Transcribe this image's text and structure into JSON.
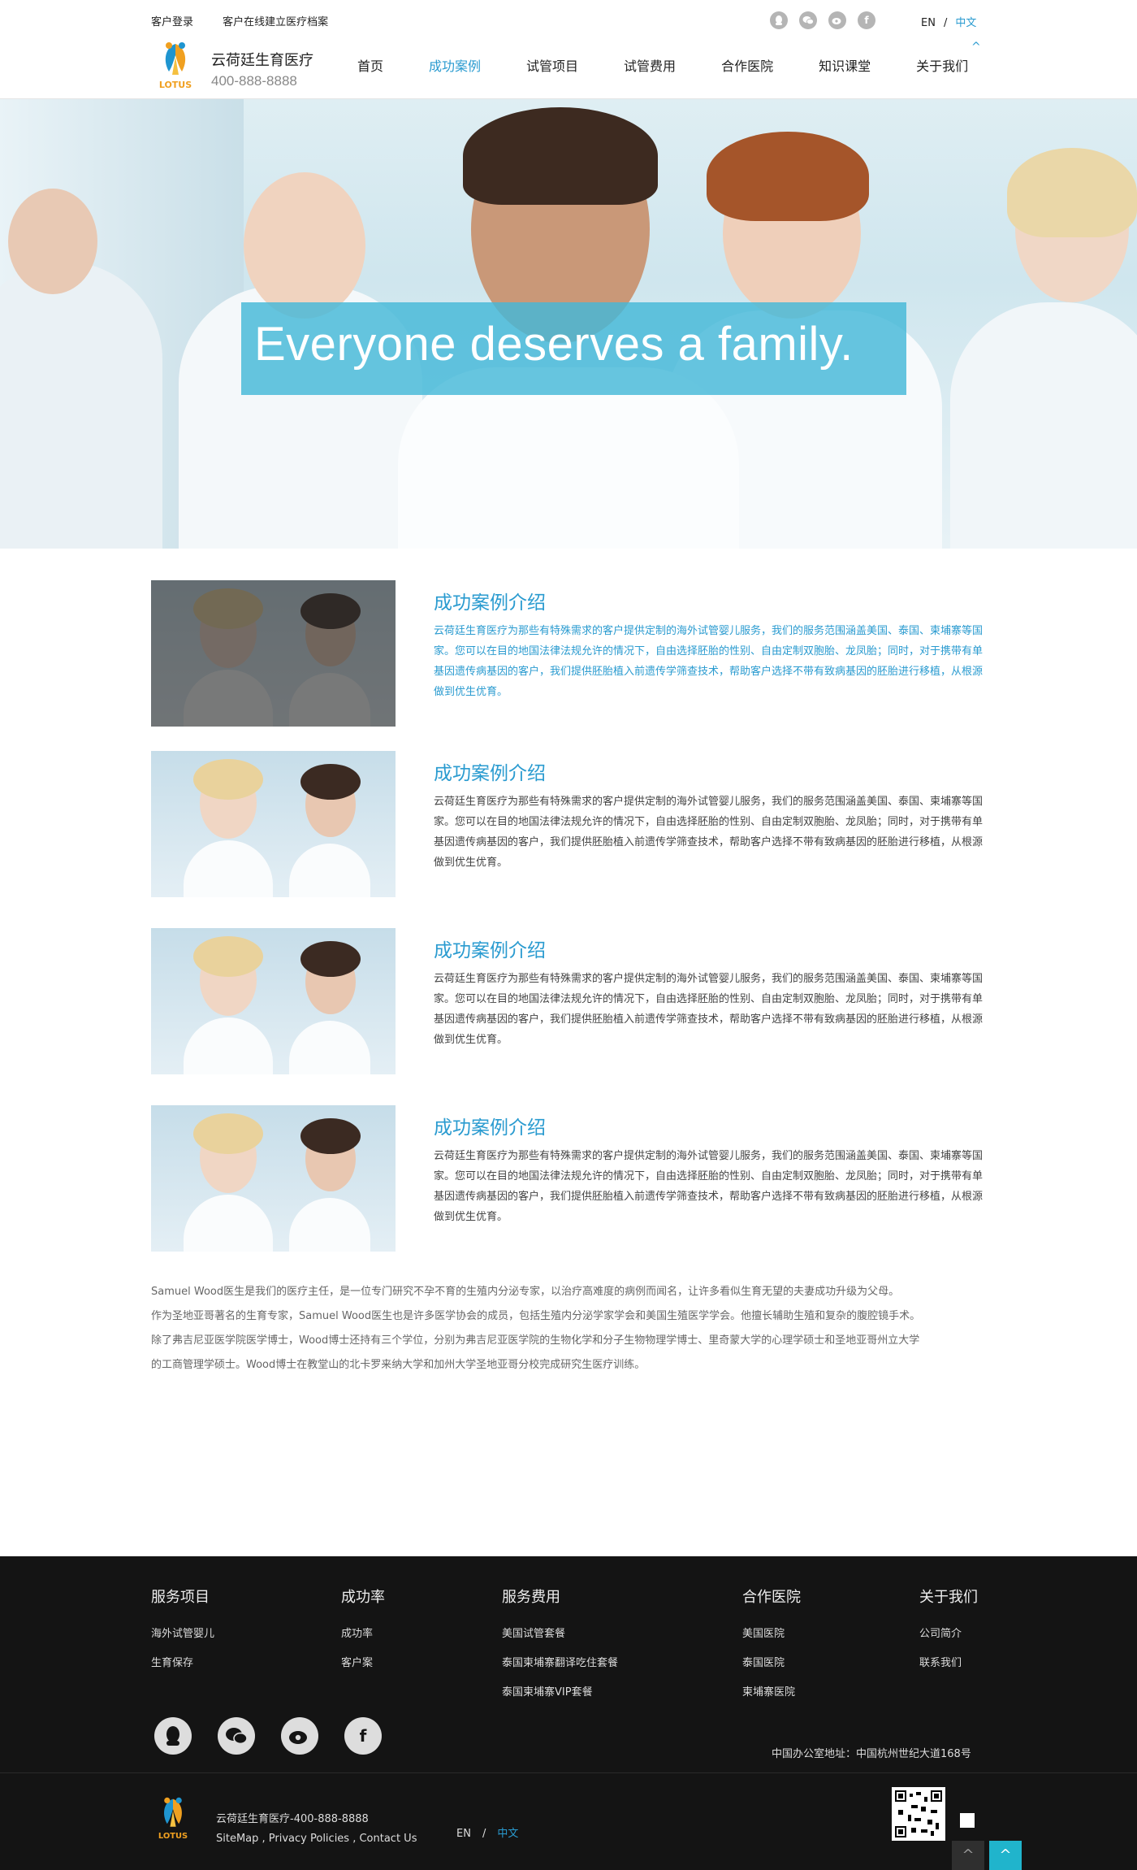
{
  "topbar": {
    "login": "客户登录",
    "archive": "客户在线建立医疗档案",
    "social_icons": [
      "qq-icon",
      "wechat-icon",
      "weibo-icon",
      "facebook-icon"
    ],
    "lang_en": "EN",
    "lang_sep": "/",
    "lang_cn": "中文"
  },
  "header": {
    "brand_name": "云荷廷生育医疗",
    "phone": "400-888-8888",
    "logo_text": "LOTUS",
    "caret": "^",
    "nav": [
      {
        "label": "首页",
        "active": false
      },
      {
        "label": "成功案例",
        "active": true
      },
      {
        "label": "试管项目",
        "active": false
      },
      {
        "label": "试管费用",
        "active": false
      },
      {
        "label": "合作医院",
        "active": false
      },
      {
        "label": "知识课堂",
        "active": false
      },
      {
        "label": "关于我们",
        "active": false
      }
    ]
  },
  "hero": {
    "caption": "Everyone deserves a family."
  },
  "cases": [
    {
      "title": "成功案例介绍",
      "desc": "云荷廷生育医疗为那些有特殊需求的客户提供定制的海外试管婴儿服务，我们的服务范围涵盖美国、泰国、柬埔寨等国家。您可以在目的地国法律法规允许的情况下，自由选择胚胎的性别、自由定制双胞胎、龙凤胎；同时，对于携带有单基因遗传病基因的客户，我们提供胚胎植入前遗传学筛查技术，帮助客户选择不带有致病基因的胚胎进行移植，从根源做到优生优育。"
    },
    {
      "title": "成功案例介绍",
      "desc": "云荷廷生育医疗为那些有特殊需求的客户提供定制的海外试管婴儿服务，我们的服务范围涵盖美国、泰国、柬埔寨等国家。您可以在目的地国法律法规允许的情况下，自由选择胚胎的性别、自由定制双胞胎、龙凤胎；同时，对于携带有单基因遗传病基因的客户，我们提供胚胎植入前遗传学筛查技术，帮助客户选择不带有致病基因的胚胎进行移植，从根源做到优生优育。"
    },
    {
      "title": "成功案例介绍",
      "desc": "云荷廷生育医疗为那些有特殊需求的客户提供定制的海外试管婴儿服务，我们的服务范围涵盖美国、泰国、柬埔寨等国家。您可以在目的地国法律法规允许的情况下，自由选择胚胎的性别、自由定制双胞胎、龙凤胎；同时，对于携带有单基因遗传病基因的客户，我们提供胚胎植入前遗传学筛查技术，帮助客户选择不带有致病基因的胚胎进行移植，从根源做到优生优育。"
    },
    {
      "title": "成功案例介绍",
      "desc": "云荷廷生育医疗为那些有特殊需求的客户提供定制的海外试管婴儿服务，我们的服务范围涵盖美国、泰国、柬埔寨等国家。您可以在目的地国法律法规允许的情况下，自由选择胚胎的性别、自由定制双胞胎、龙凤胎；同时，对于携带有单基因遗传病基因的客户，我们提供胚胎植入前遗传学筛查技术，帮助客户选择不带有致病基因的胚胎进行移植，从根源做到优生优育。"
    }
  ],
  "bio": {
    "lines": [
      "Samuel Wood医生是我们的医疗主任，是一位专门研究不孕不育的生殖内分泌专家，以治疗高难度的病例而闻名，让许多看似生育无望的夫妻成功升级为父母。",
      "作为圣地亚哥著名的生育专家，Samuel Wood医生也是许多医学协会的成员，包括生殖内分泌学家学会和美国生殖医学学会。他擅长辅助生殖和复杂的腹腔镜手术。",
      "除了弗吉尼亚医学院医学博士，Wood博士还持有三个学位，分别为弗吉尼亚医学院的生物化学和分子生物物理学博士、里奇蒙大学的心理学硕士和圣地亚哥州立大学",
      "的工商管理学硕士。Wood博士在教堂山的北卡罗来纳大学和加州大学圣地亚哥分校完成研究生医疗训练。"
    ]
  },
  "footer": {
    "columns": [
      {
        "heading": "服务项目",
        "links": [
          "海外试管婴儿",
          "生育保存"
        ]
      },
      {
        "heading": "成功率",
        "links": [
          "成功率",
          "客户案"
        ]
      },
      {
        "heading": "服务费用",
        "links": [
          "美国试管套餐",
          "泰国柬埔寨翻译吃住套餐",
          "泰国柬埔寨VIP套餐"
        ]
      },
      {
        "heading": "合作医院",
        "links": [
          "美国医院",
          "泰国医院",
          "柬埔寨医院"
        ]
      },
      {
        "heading": "关于我们",
        "links": [
          "公司简介",
          "联系我们"
        ]
      }
    ],
    "social_icons": [
      "qq-icon",
      "wechat-icon",
      "weibo-icon",
      "facebook-icon"
    ],
    "address": "中国办公室地址：中国杭州世纪大道168号",
    "brand_line": "云荷廷生育医疗-400-888-8888",
    "links_line": "SiteMap ,  Privacy Policies , Contact Us",
    "logo_text": "LOTUS",
    "lang_en": "EN",
    "lang_sep": "/",
    "lang_cn": "中文",
    "back_top": "^"
  },
  "colors": {
    "accent": "#2a9bd0",
    "footer_bg": "#141414",
    "hero_caption": "#44b8d8",
    "back_top": "#20b4cc"
  }
}
